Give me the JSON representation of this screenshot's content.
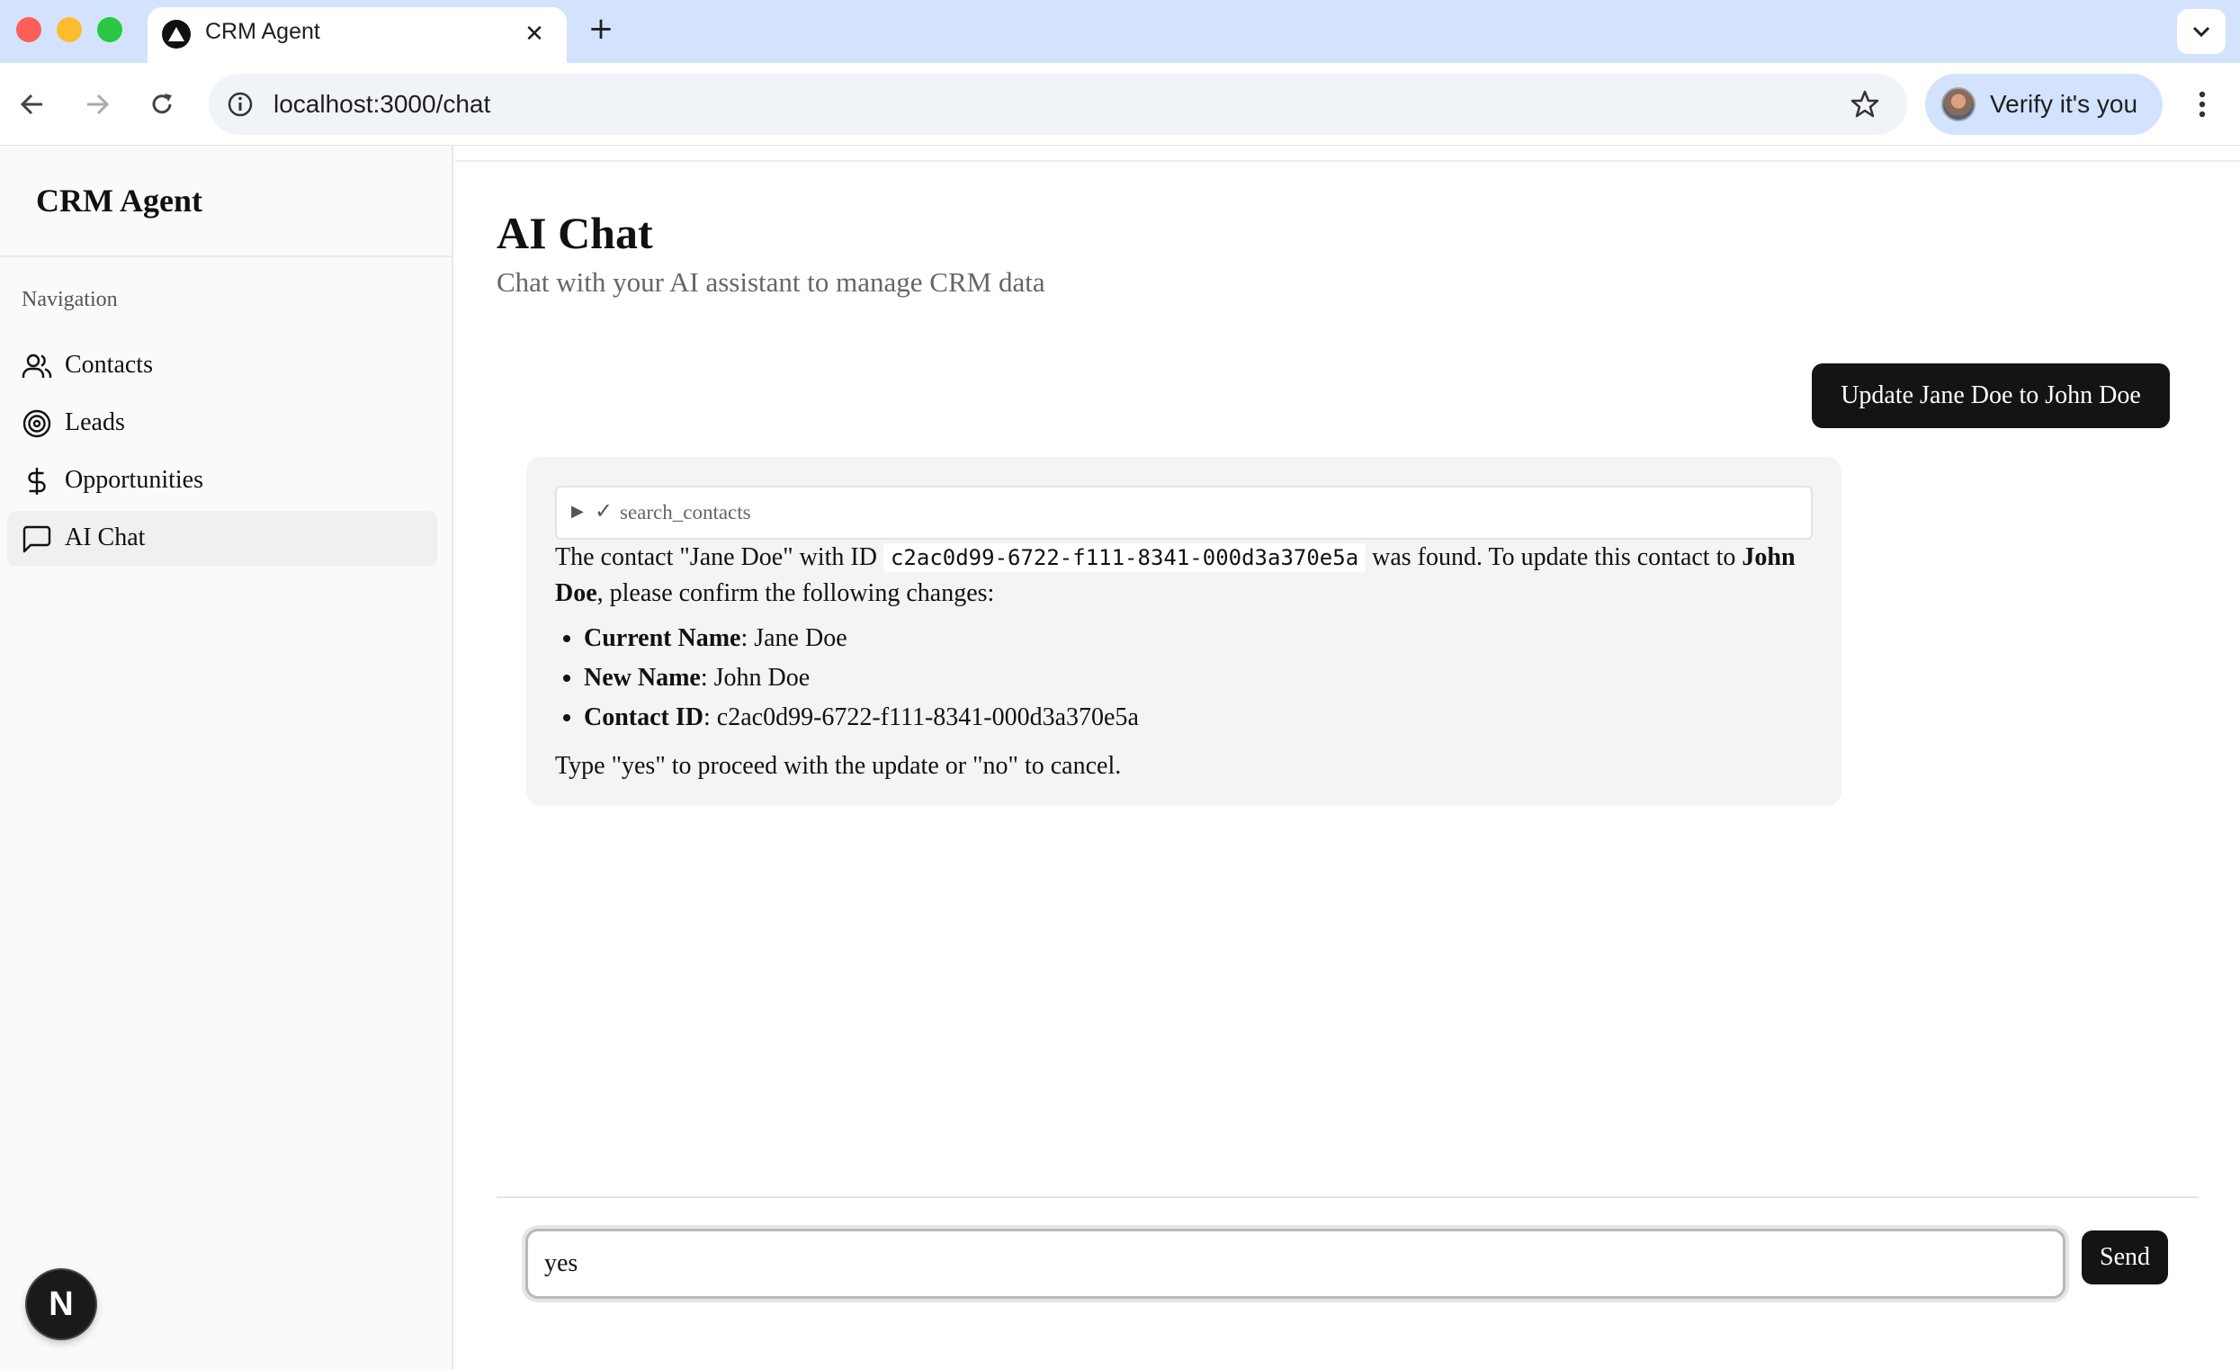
{
  "browser": {
    "tab_title": "CRM Agent",
    "url": "localhost:3000/chat",
    "profile_label": "Verify it's you"
  },
  "sidebar": {
    "app_title": "CRM Agent",
    "group_label": "Navigation",
    "items": [
      {
        "label": "Contacts",
        "icon": "users-icon",
        "active": false
      },
      {
        "label": "Leads",
        "icon": "target-icon",
        "active": false
      },
      {
        "label": "Opportunities",
        "icon": "dollar-icon",
        "active": false
      },
      {
        "label": "AI Chat",
        "icon": "message-square-icon",
        "active": true
      }
    ],
    "dev_badge": "N"
  },
  "main": {
    "title": "AI Chat",
    "subtitle": "Chat with your AI assistant to manage CRM data"
  },
  "chat": {
    "user_message": "Update Jane Doe to John Doe",
    "assistant": {
      "tool_call": {
        "status": "✓",
        "name": "search_contacts"
      },
      "para_before_id": "The contact \"Jane Doe\" with ID",
      "contact_id_code": "c2ac0d99-6722-f111-8341-000d3a370e5a",
      "para_after_id": "was found. To update this contact to",
      "para_bold_name": "John Doe",
      "para_tail": ", please confirm the following changes:",
      "items": [
        {
          "label": "Current Name",
          "value": ": Jane Doe"
        },
        {
          "label": "New Name",
          "value": ": John Doe"
        },
        {
          "label": "Contact ID",
          "value": ": c2ac0d99-6722-f111-8341-000d3a370e5a"
        }
      ],
      "footer": "Type \"yes\" to proceed with the update or \"no\" to cancel."
    }
  },
  "composer": {
    "value": "yes",
    "send_label": "Send"
  },
  "colors": {
    "tabbar_bg": "#d3e3fd",
    "sidebar_bg": "#fafafa",
    "user_bubble": "#141414",
    "assistant_bubble": "#f4f4f4"
  }
}
